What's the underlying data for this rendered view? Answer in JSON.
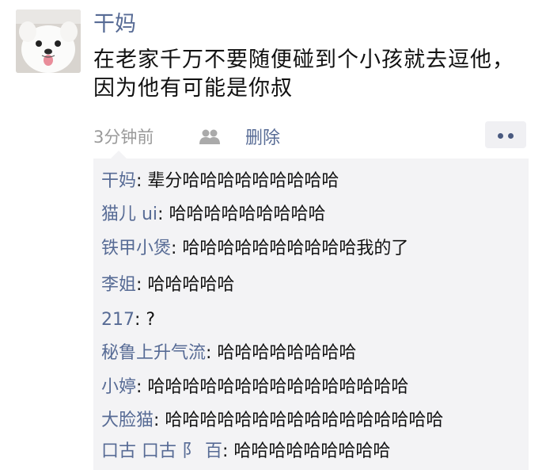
{
  "post": {
    "author": "干妈",
    "text": "在老家千万不要随便碰到个小孩就去逗他，因为他有可能是你叔",
    "timestamp": "3分钟前",
    "delete_label": "删除",
    "visibility_icon": "friends-icon",
    "more_icon": "more-dots-icon"
  },
  "comments": [
    {
      "name": "干妈",
      "sep": ": ",
      "text": "辈分哈哈哈哈哈哈哈哈哈"
    },
    {
      "name": "猫儿 ui",
      "sep": ": ",
      "text": "哈哈哈哈哈哈哈哈哈"
    },
    {
      "name": "铁甲小煲",
      "sep": ": ",
      "text": "哈哈哈哈哈哈哈哈哈哈我的了"
    },
    {
      "name": "李姐",
      "sep": ": ",
      "text": "哈哈哈哈哈"
    },
    {
      "name": "217",
      "sep": ": ",
      "text": "?"
    },
    {
      "name": "秘鲁上升气流",
      "sep": ": ",
      "text": "哈哈哈哈哈哈哈哈"
    },
    {
      "name": "小婷",
      "sep": ": ",
      "text": "哈哈哈哈哈哈哈哈哈哈哈哈哈哈哈"
    },
    {
      "name": "大脸猫",
      "sep": ": ",
      "text": "哈哈哈哈哈哈哈哈哈哈哈哈哈哈哈哈"
    },
    {
      "name": "口古 口古 阝 百",
      "sep": ": ",
      "text": "哈哈哈哈哈哈哈哈哈"
    }
  ]
}
